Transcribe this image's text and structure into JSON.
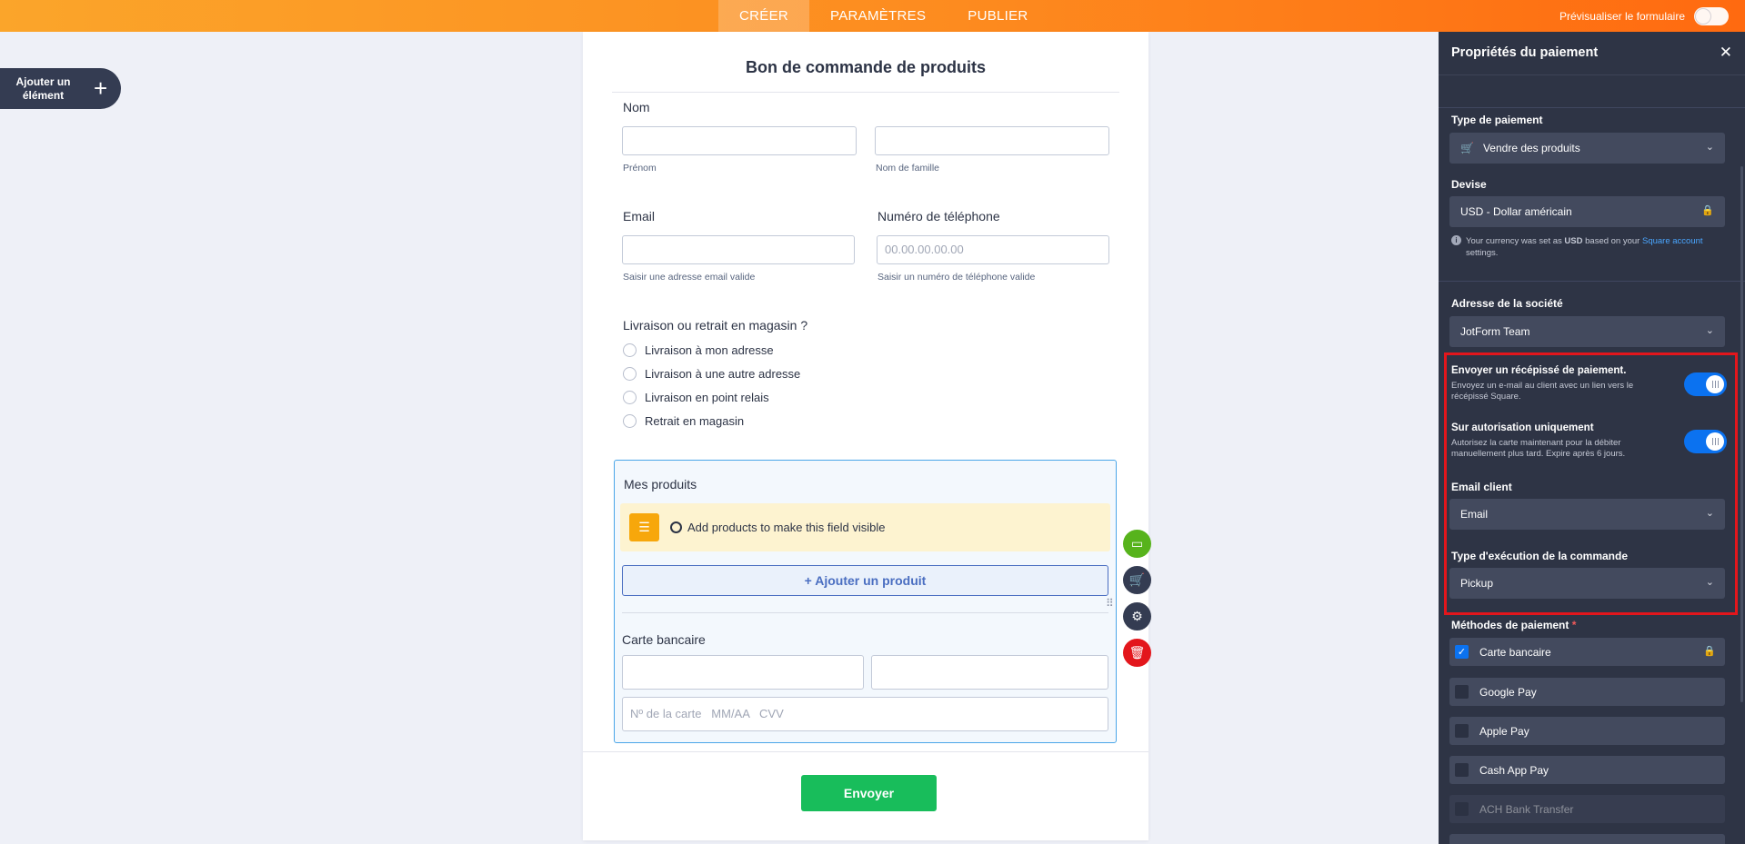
{
  "topbar": {
    "tabs": [
      {
        "label": "CRÉER",
        "active": true
      },
      {
        "label": "PARAMÈTRES",
        "active": false
      },
      {
        "label": "PUBLIER",
        "active": false
      }
    ],
    "preview_label": "Prévisualiser le formulaire"
  },
  "sidebar": {
    "add_element_label": "Ajouter un élément"
  },
  "form": {
    "title": "Bon de commande de produits",
    "name": {
      "label": "Nom",
      "first_sub": "Prénom",
      "last_sub": "Nom de famille"
    },
    "email": {
      "label": "Email",
      "sub": "Saisir une adresse email valide"
    },
    "phone": {
      "label": "Numéro de téléphone",
      "placeholder": "00.00.00.00.00",
      "sub": "Saisir un numéro de téléphone valide"
    },
    "delivery": {
      "label": "Livraison ou retrait en magasin ?",
      "options": [
        "Livraison à mon adresse",
        "Livraison à une autre adresse",
        "Livraison en point relais",
        "Retrait en magasin"
      ]
    },
    "products": {
      "label": "Mes produits",
      "notice": "Add products to make this field visible",
      "add_button": "+ Ajouter un produit",
      "card_label": "Carte bancaire",
      "card_placeholder": "Nº de la carte   MM/AA   CVV"
    },
    "submit_label": "Envoyer"
  },
  "panel": {
    "title": "Propriétés du paiement",
    "payment_type": {
      "label": "Type de paiement",
      "value": "Vendre des produits"
    },
    "currency": {
      "label": "Devise",
      "value": "USD - Dollar américain",
      "info_pre": "Your currency was set as ",
      "info_bold": "USD",
      "info_mid": " based on your ",
      "info_link": "Square account",
      "info_post": " settings."
    },
    "company": {
      "label": "Adresse de la société",
      "value": "JotForm Team"
    },
    "receipt": {
      "title": "Envoyer un récépissé de paiement.",
      "desc": "Envoyez un e-mail au client avec un lien vers le récépissé Square.",
      "on": true
    },
    "authorize": {
      "title": "Sur autorisation uniquement",
      "desc": "Autorisez la carte maintenant pour la débiter manuellement plus tard. Expire après 6 jours.",
      "on": true
    },
    "client_email": {
      "label": "Email client",
      "value": "Email"
    },
    "fulfillment": {
      "label": "Type d'exécution de la commande",
      "value": "Pickup"
    },
    "methods": {
      "label": "Méthodes de paiement",
      "required_mark": "*",
      "items": [
        {
          "label": "Carte bancaire",
          "checked": true,
          "locked": true
        },
        {
          "label": "Google Pay",
          "checked": false
        },
        {
          "label": "Apple Pay",
          "checked": false
        },
        {
          "label": "Cash App Pay",
          "checked": false
        },
        {
          "label": "ACH Bank Transfer",
          "checked": false,
          "disabled": true
        }
      ]
    }
  },
  "colors": {
    "accent_orange": "#ff8a1c",
    "panel_bg": "#2e3445",
    "toggle_blue": "#0b72f0",
    "submit_green": "#18bd5b",
    "highlight_red": "#e3161c"
  }
}
